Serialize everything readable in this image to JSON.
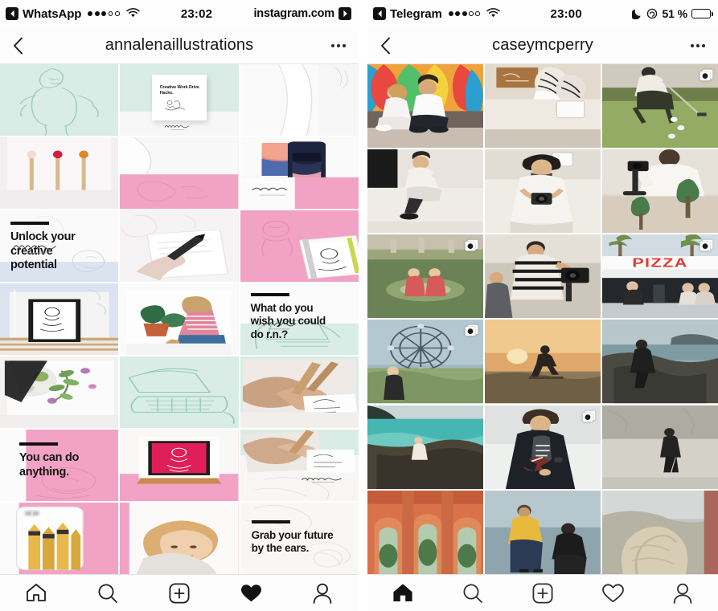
{
  "phones": [
    {
      "id": "left",
      "status": {
        "back_app": "WhatsApp",
        "signal_filled": 3,
        "signal_total": 5,
        "wifi": "wifi-icon",
        "time": "23:02",
        "right_label": "instagram.com",
        "forward_icon": "forward-arrow-icon"
      },
      "nav": {
        "back": "back-chevron-icon",
        "title": "annalenaillustrations",
        "more": "more-options-icon"
      },
      "tabbar": {
        "items": [
          {
            "name": "home",
            "icon": "home-icon",
            "active": false
          },
          {
            "name": "search",
            "icon": "search-icon",
            "active": false
          },
          {
            "name": "add",
            "icon": "add-post-icon",
            "active": false
          },
          {
            "name": "activity",
            "icon": "heart-icon",
            "active": true
          },
          {
            "name": "profile",
            "icon": "person-icon",
            "active": false
          }
        ]
      },
      "grid": {
        "columns": 3,
        "cells": [
          {
            "kind": "art",
            "name": "cell-sketch-mint",
            "bg": "#d9ece6",
            "art": "sketch-figure"
          },
          {
            "kind": "art",
            "name": "cell-book-mockup",
            "bg": "#eef3f1",
            "art": "book-cover",
            "caption": "Creative Work Drive Hacks."
          },
          {
            "kind": "art",
            "name": "cell-white-paper",
            "bg": "#f7f7f7",
            "art": "paper-fold"
          },
          {
            "kind": "art",
            "name": "cell-matches",
            "bg": "#f4eff0",
            "art": "matchsticks"
          },
          {
            "kind": "art",
            "name": "cell-paper-curl",
            "bg": "#f3f3f3",
            "art": "paper-curl"
          },
          {
            "kind": "art",
            "name": "cell-phone-case",
            "bg": "#f3f3f3",
            "art": "phone-case"
          },
          {
            "kind": "text",
            "name": "cell-quote-unlock",
            "bg": "#fbfbfb",
            "quote": "Unlock your\ncreative\npotential",
            "signature": "annalena"
          },
          {
            "kind": "art",
            "name": "cell-hand-writing",
            "bg": "#f2f0f1",
            "art": "hand-writing"
          },
          {
            "kind": "art",
            "name": "cell-pink-sketchbook",
            "bg": "#f2a2c4",
            "art": "sketchbook"
          },
          {
            "kind": "art",
            "name": "cell-framed-print",
            "bg": "#dbe3f0",
            "art": "framed-print"
          },
          {
            "kind": "art",
            "name": "cell-girl-plant",
            "bg": "#f8f8f8",
            "art": "girl-with-plant"
          },
          {
            "kind": "text",
            "name": "cell-quote-wish",
            "bg": "#fafafa",
            "quote": "What do you\nwish you could\ndo r.n.?",
            "signature": "annalena"
          },
          {
            "kind": "art",
            "name": "cell-palette",
            "bg": "#efeeed",
            "art": "paint-palette"
          },
          {
            "kind": "art",
            "name": "cell-mint-typewriter",
            "bg": "#d9ece6",
            "art": "typewriter-sketch"
          },
          {
            "kind": "art",
            "name": "cell-hands-drawing",
            "bg": "#ece7e3",
            "art": "hands-drawing"
          },
          {
            "kind": "text",
            "name": "cell-quote-anything",
            "bg": "#f2a2c4",
            "quote": "You can do\nanything.",
            "signature": ""
          },
          {
            "kind": "art",
            "name": "cell-pink-poster",
            "bg": "#f4f3f2",
            "art": "pink-poster"
          },
          {
            "kind": "art",
            "name": "cell-sketch-pale",
            "bg": "#f6f4f3",
            "art": "pale-sketch"
          },
          {
            "kind": "art",
            "name": "cell-pencils-case",
            "bg": "#f6f5f4",
            "art": "pencils-phone-case"
          },
          {
            "kind": "art",
            "name": "cell-blonde-girl",
            "bg": "#ece9e6",
            "art": "blonde-girl"
          },
          {
            "kind": "text",
            "name": "cell-quote-grab",
            "bg": "#f7f6f5",
            "quote": "Grab your future\nby the ears.",
            "signature": ""
          }
        ]
      }
    },
    {
      "id": "right",
      "status": {
        "back_app": "Telegram",
        "signal_filled": 3,
        "signal_total": 5,
        "wifi": "wifi-icon",
        "time": "23:00",
        "moon": "moon-icon",
        "rotation_lock": "rotation-lock-icon",
        "battery_pct": "51 %",
        "battery_level": 51
      },
      "nav": {
        "back": "back-chevron-icon",
        "title": "caseymcperry",
        "more": "more-options-icon"
      },
      "tabbar": {
        "items": [
          {
            "name": "home",
            "icon": "home-icon",
            "active": true
          },
          {
            "name": "search",
            "icon": "search-icon",
            "active": false
          },
          {
            "name": "add",
            "icon": "add-post-icon",
            "active": false
          },
          {
            "name": "activity",
            "icon": "heart-icon",
            "active": false
          },
          {
            "name": "profile",
            "icon": "person-icon",
            "active": false
          }
        ]
      },
      "grid": {
        "columns": 3,
        "cells": [
          {
            "kind": "photo",
            "name": "cell-couple-mural",
            "art": "couple-mural",
            "carousel": false
          },
          {
            "kind": "photo",
            "name": "cell-sneakers",
            "art": "sneakers-shelf",
            "carousel": false
          },
          {
            "kind": "photo",
            "name": "cell-golfer",
            "art": "golfer-putting",
            "carousel": true
          },
          {
            "kind": "photo",
            "name": "cell-seated-man",
            "art": "seated-man",
            "carousel": false
          },
          {
            "kind": "photo",
            "name": "cell-camera-man",
            "art": "man-with-camera",
            "carousel": false
          },
          {
            "kind": "photo",
            "name": "cell-gimbal-operator",
            "art": "gimbal-operator",
            "carousel": false
          },
          {
            "kind": "photo",
            "name": "cell-fountain-park",
            "art": "fountain-park",
            "carousel": true
          },
          {
            "kind": "photo",
            "name": "cell-filming-crew",
            "art": "filming-crew",
            "carousel": false
          },
          {
            "kind": "photo",
            "name": "cell-pizza-stand",
            "art": "pizza-stand",
            "caption": "PIZZA",
            "carousel": true
          },
          {
            "kind": "photo",
            "name": "cell-ferris-wheel",
            "art": "ferris-wheel",
            "carousel": true
          },
          {
            "kind": "photo",
            "name": "cell-sunset-jump",
            "art": "sunset-jump",
            "carousel": false
          },
          {
            "kind": "photo",
            "name": "cell-cliff-man",
            "art": "cliff-man",
            "carousel": false
          },
          {
            "kind": "photo",
            "name": "cell-lagoon",
            "art": "lagoon-rocks",
            "carousel": false
          },
          {
            "kind": "photo",
            "name": "cell-football-man",
            "art": "man-with-football",
            "carousel": true
          },
          {
            "kind": "photo",
            "name": "cell-wall-walker",
            "art": "wall-walker",
            "carousel": false
          },
          {
            "kind": "photo",
            "name": "cell-arches",
            "art": "orange-arches",
            "carousel": false
          },
          {
            "kind": "photo",
            "name": "cell-yellow-jacket",
            "art": "yellow-jacket",
            "carousel": false
          },
          {
            "kind": "photo",
            "name": "cell-boulder",
            "art": "boulder-rock",
            "carousel": false
          }
        ]
      }
    }
  ]
}
